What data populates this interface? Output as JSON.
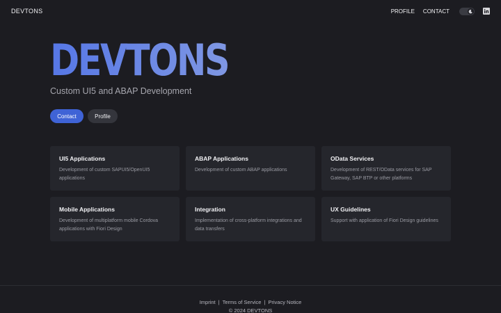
{
  "header": {
    "brand": "DEVTONS",
    "nav": [
      "PROFILE",
      "CONTACT"
    ]
  },
  "hero": {
    "title": "DEVTONS",
    "subtitle": "Custom UI5 and ABAP Development",
    "buttons": {
      "primary": "Contact",
      "secondary": "Profile"
    }
  },
  "services": [
    {
      "title": "UI5 Applications",
      "description": "Development of custom SAPUI5/OpenUI5 applications"
    },
    {
      "title": "ABAP Applications",
      "description": "Development of custom ABAP applications"
    },
    {
      "title": "OData Services",
      "description": "Development of REST/OData services for SAP Gateway, SAP BTP or other platforms"
    },
    {
      "title": "Mobile Applications",
      "description": "Development of multiplatform mobile Cordova applications with Fiori Design"
    },
    {
      "title": "Integration",
      "description": "Implementation of cross-platform integrations and data transfers"
    },
    {
      "title": "UX Guidelines",
      "description": "Support with application of Fiori Design guidelines"
    }
  ],
  "footer": {
    "links": [
      "Imprint",
      "Terms of Service",
      "Privacy Notice"
    ],
    "copyright": "© 2024 DEVTONS"
  },
  "icons": {
    "theme_toggle": "moon-icon",
    "social": "linkedin-icon"
  },
  "colors": {
    "background": "#1c1c21",
    "accent": "#3f63d6",
    "card": "#25262c"
  }
}
